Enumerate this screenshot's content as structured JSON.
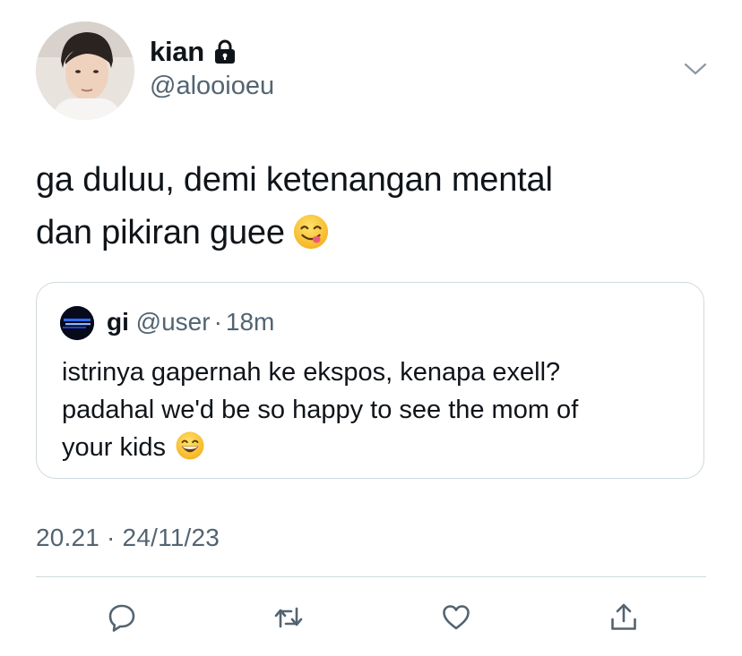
{
  "author": {
    "name": "kian",
    "handle": "@alooioeu",
    "protected_icon": "lock-icon",
    "avatar_icon": "profile-photo"
  },
  "tweet": {
    "line1": "ga duluu, demi ketenangan mental",
    "line2": "dan pikiran guee",
    "emoji": "😋"
  },
  "quoted_tweet": {
    "name": "gi",
    "handle": "@user",
    "separator": "·",
    "time": "18m",
    "line1": "istrinya gapernah ke ekspos, kenapa exell?",
    "line2": "padahal we'd be so happy to see the mom of",
    "line3": "your kids",
    "emoji": "😄"
  },
  "timestamp": "20.21 · 24/11/23",
  "actions": [
    "reply-icon",
    "retweet-icon",
    "like-icon",
    "share-icon"
  ],
  "colors": {
    "text": "#0f1419",
    "secondary": "#536471",
    "border": "#cfd9de"
  }
}
